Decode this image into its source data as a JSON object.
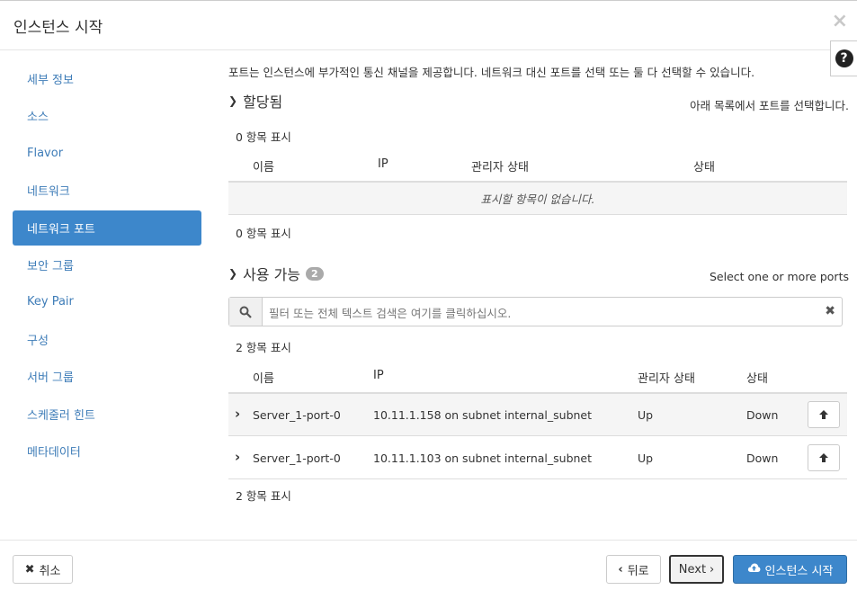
{
  "modal": {
    "title": "인스턴스 시작",
    "close": "×",
    "help": "?"
  },
  "sidebar": {
    "items": [
      {
        "label": "세부 정보"
      },
      {
        "label": "소스"
      },
      {
        "label": "Flavor"
      },
      {
        "label": "네트워크"
      },
      {
        "label": "네트워크 포트",
        "active": true
      },
      {
        "label": "보안 그룹"
      },
      {
        "label": "Key Pair"
      },
      {
        "label": "구성"
      },
      {
        "label": "서버 그룹"
      },
      {
        "label": "스케줄러 힌트"
      },
      {
        "label": "메타데이터"
      }
    ]
  },
  "intro": "포트는 인스턴스에 부가적인 통신 채널을 제공합니다. 네트워크 대신 포트를 선택 또는 둘 다 선택할 수 있습니다.",
  "allocated": {
    "title": "할당됨",
    "help": "아래 목록에서 포트를 선택합니다.",
    "count_top": "0 항목 표시",
    "count_bottom": "0 항목 표시",
    "columns": [
      "이름",
      "IP",
      "관리자 상태",
      "상태"
    ],
    "empty": "표시할 항목이 없습니다."
  },
  "available": {
    "title": "사용 가능",
    "badge": "2",
    "help": "Select one or more ports",
    "search_placeholder": "필터 또는 전체 텍스트 검색은 여기를 클릭하십시오.",
    "count_top": "2 항목 표시",
    "count_bottom": "2 항목 표시",
    "columns": [
      "이름",
      "IP",
      "관리자 상태",
      "상태"
    ],
    "rows": [
      {
        "name": "Server_1-port-0",
        "ip": "10.11.1.158 on subnet internal_subnet",
        "admin": "Up",
        "status": "Down"
      },
      {
        "name": "Server_1-port-0",
        "ip": "10.11.1.103 on subnet internal_subnet",
        "admin": "Up",
        "status": "Down"
      }
    ]
  },
  "footer": {
    "cancel": "취소",
    "back": "뒤로",
    "next": "Next",
    "launch": "인스턴스 시작"
  }
}
